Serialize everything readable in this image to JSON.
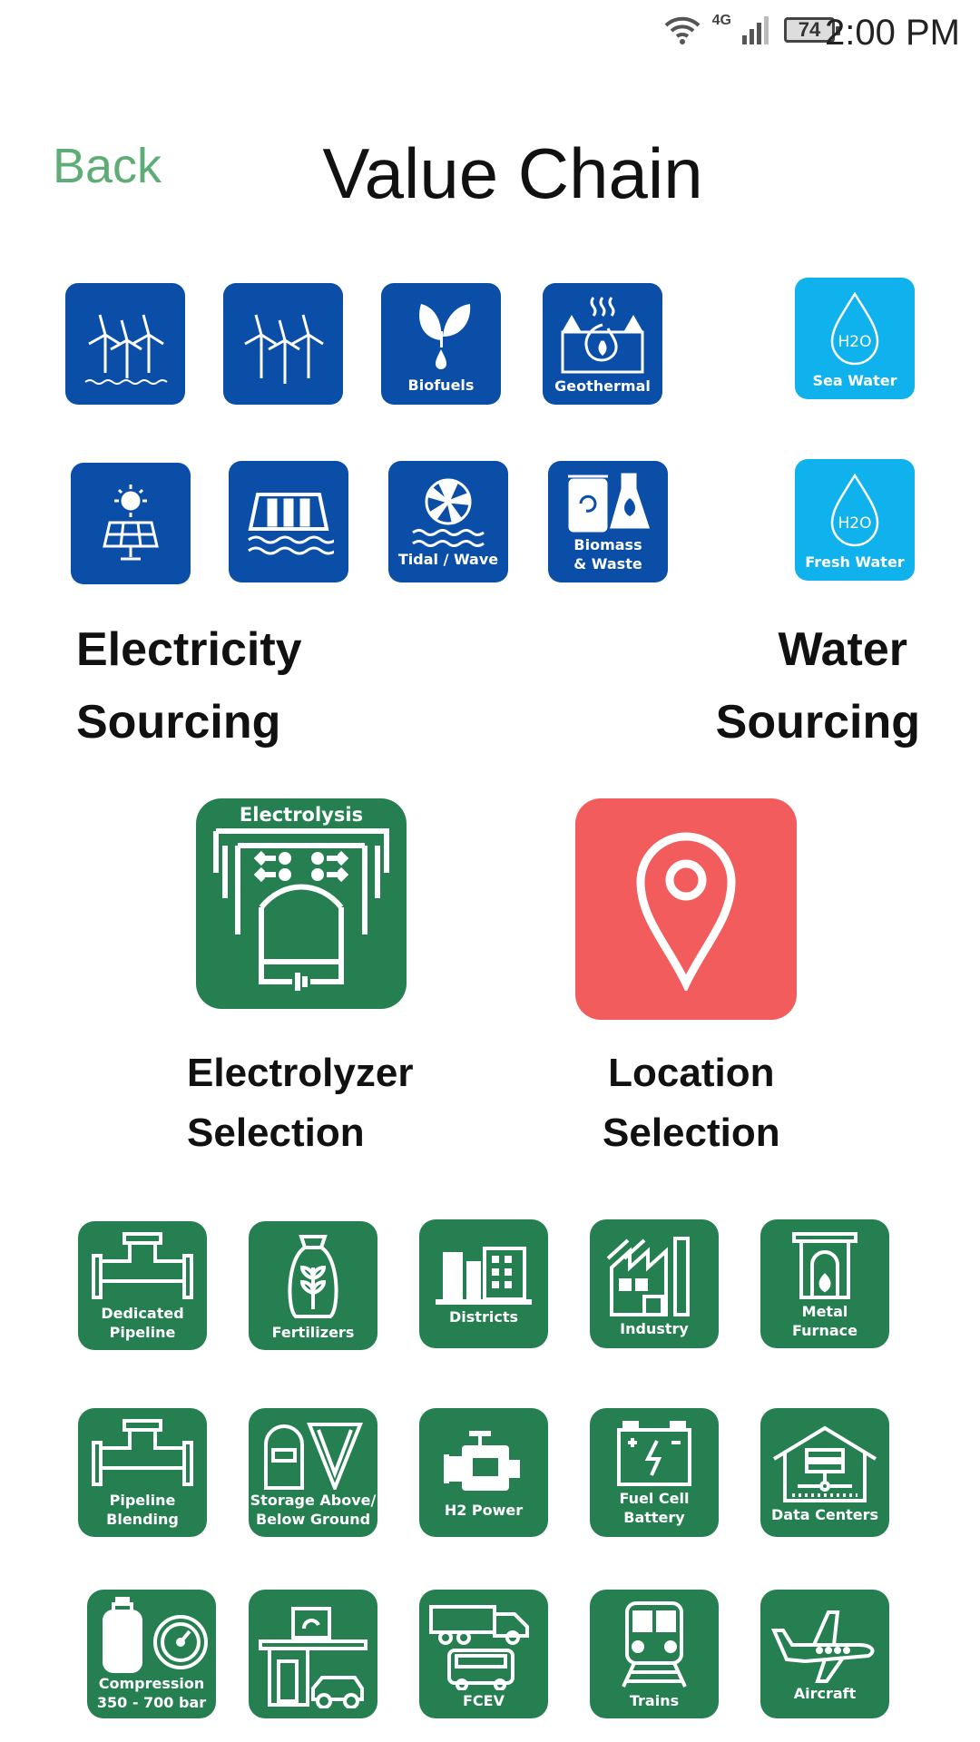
{
  "status": {
    "network": "4G",
    "battery": "74",
    "time": "2:00 PM"
  },
  "header": {
    "back_label": "Back",
    "title": "Value Chain"
  },
  "electricity": {
    "heading_line1": "Electricity",
    "heading_line2": "Sourcing",
    "tiles": [
      {
        "label": "",
        "icon": "offshore-wind-icon"
      },
      {
        "label": "",
        "icon": "onshore-wind-icon"
      },
      {
        "label": "Biofuels",
        "icon": "biofuels-icon"
      },
      {
        "label": "Geothermal",
        "icon": "geothermal-icon"
      },
      {
        "label": "",
        "icon": "solar-icon"
      },
      {
        "label": "",
        "icon": "hydro-dam-icon"
      },
      {
        "label": "Tidal / Wave",
        "icon": "tidal-wave-icon"
      },
      {
        "label_line1": "Biomass",
        "label_line2": "& Waste",
        "icon": "biomass-waste-icon"
      }
    ]
  },
  "water": {
    "heading_line1": "Water",
    "heading_line2": "Sourcing",
    "tiles": [
      {
        "label": "Sea Water",
        "icon": "sea-water-drop-icon"
      },
      {
        "label": "Fresh Water",
        "icon": "fresh-water-drop-icon"
      }
    ],
    "drop_symbol": "H2O"
  },
  "electrolyzer": {
    "tile_label": "Electrolysis",
    "label_line1": "Electrolyzer",
    "label_line2": "Selection",
    "color": "#267f50"
  },
  "location": {
    "label_line1": "Location",
    "label_line2": "Selection",
    "color": "#f25c5c"
  },
  "uses": {
    "color": "#267f50",
    "tiles": [
      {
        "line1": "Dedicated",
        "line2": "Pipeline",
        "icon": "pipeline-icon"
      },
      {
        "line1": "Fertilizers",
        "line2": "",
        "icon": "fertilizer-bag-icon"
      },
      {
        "line1": "Districts",
        "line2": "",
        "icon": "districts-icon"
      },
      {
        "line1": "Industry",
        "line2": "",
        "icon": "industry-icon"
      },
      {
        "line1": "Metal",
        "line2": "Furnace",
        "icon": "furnace-icon"
      },
      {
        "line1": "Pipeline",
        "line2": "Blending",
        "icon": "pipeline-blending-icon"
      },
      {
        "line1": "Storage Above/",
        "line2": "Below Ground",
        "icon": "storage-icon"
      },
      {
        "line1": "H2 Power",
        "line2": "",
        "icon": "h2-power-icon"
      },
      {
        "line1": "Fuel Cell",
        "line2": "Battery",
        "icon": "battery-icon"
      },
      {
        "line1": "Data Centers",
        "line2": "",
        "icon": "data-center-icon"
      },
      {
        "line1": "Compression",
        "line2": "350 - 700 bar",
        "icon": "compression-gauge-icon"
      },
      {
        "line1": "",
        "line2": "",
        "icon": "fuel-station-icon"
      },
      {
        "line1": "FCEV",
        "line2": "",
        "icon": "fcev-truck-icon"
      },
      {
        "line1": "Trains",
        "line2": "",
        "icon": "train-icon"
      },
      {
        "line1": "Aircraft",
        "line2": "",
        "icon": "aircraft-icon"
      }
    ]
  }
}
